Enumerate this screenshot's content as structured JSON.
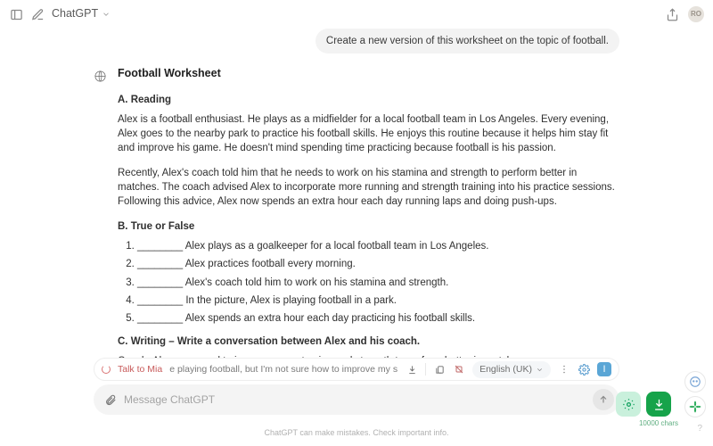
{
  "top": {
    "title": "ChatGPT",
    "avatar_initials": "RO"
  },
  "chat": {
    "user_message": "Create a new version of this worksheet on the topic of football.",
    "assistant": {
      "title": "Football Worksheet",
      "sections": {
        "reading": {
          "heading": "A. Reading",
          "p1": "Alex is a football enthusiast. He plays as a midfielder for a local football team in Los Angeles. Every evening, Alex goes to the nearby park to practice his football skills. He enjoys this routine because it helps him stay fit and improve his game. He doesn't mind spending time practicing because football is his passion.",
          "p2": "Recently, Alex's coach told him that he needs to work on his stamina and strength to perform better in matches. The coach advised Alex to incorporate more running and strength training into his practice sessions. Following this advice, Alex now spends an extra hour each day running laps and doing push-ups."
        },
        "truefalse": {
          "heading": "B. True or False",
          "items": [
            "________ Alex plays as a goalkeeper for a local football team in Los Angeles.",
            "________ Alex practices football every morning.",
            "________ Alex's coach told him to work on his stamina and strength.",
            "________ In the picture, Alex is playing football in a park.",
            "________ Alex spends an extra hour each day practicing his football skills."
          ]
        },
        "writing": {
          "heading": "C. Writing – Write a conversation between Alex and his coach.",
          "line": "Coach: Alex, you need to improve your stamina and strength to perform better in matches."
        }
      }
    }
  },
  "ext_bar": {
    "talk_label": "Talk to Mia",
    "snippet": "e playing football, but I'm not sure how to improve my s",
    "language": "English (UK)"
  },
  "composer": {
    "placeholder": "Message ChatGPT",
    "chars_label": "10000 chars"
  },
  "footer": "ChatGPT can make mistakes. Check important info."
}
